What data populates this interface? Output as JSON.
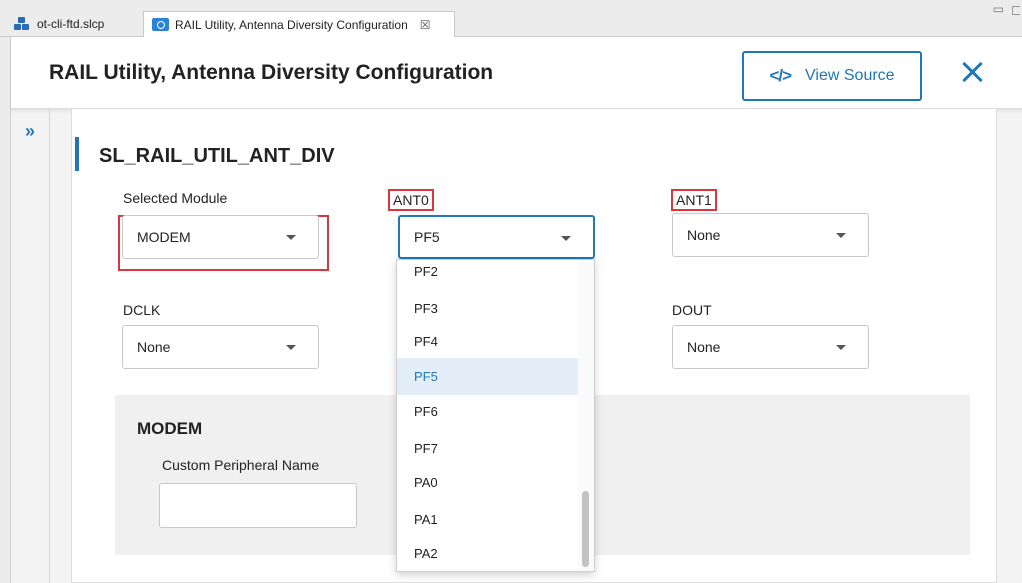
{
  "tabs": [
    {
      "label": "ot-cli-ftd.slcp",
      "icon": "project-icon"
    },
    {
      "label": "RAIL Utility, Antenna Diversity Configuration",
      "icon": "config-icon",
      "close": "☒"
    }
  ],
  "header": {
    "title": "RAIL Utility, Antenna Diversity Configuration",
    "view_source_icon": "</>",
    "view_source_label": "View Source"
  },
  "sidebar": {
    "expand_glyph": "»"
  },
  "section": {
    "title": "SL_RAIL_UTIL_ANT_DIV"
  },
  "fields": {
    "selected_module": {
      "label": "Selected Module",
      "value": "MODEM"
    },
    "ant0": {
      "label": "ANT0",
      "value": "PF5"
    },
    "ant1": {
      "label": "ANT1",
      "value": "None"
    },
    "dclk": {
      "label": "DCLK",
      "value": "None"
    },
    "dout": {
      "label": "DOUT",
      "value": "None"
    }
  },
  "modem": {
    "title": "MODEM",
    "custom_peripheral_label": "Custom Peripheral Name",
    "custom_peripheral_value": ""
  },
  "dropdown": {
    "options": [
      "PF2",
      "PF3",
      "PF4",
      "PF5",
      "PF6",
      "PF7",
      "PA0",
      "PA1",
      "PA2"
    ],
    "selected": "PF5"
  },
  "colors": {
    "accent": "#1f77b8",
    "highlight": "#d9363e",
    "selected_bg": "#e4eef8"
  }
}
